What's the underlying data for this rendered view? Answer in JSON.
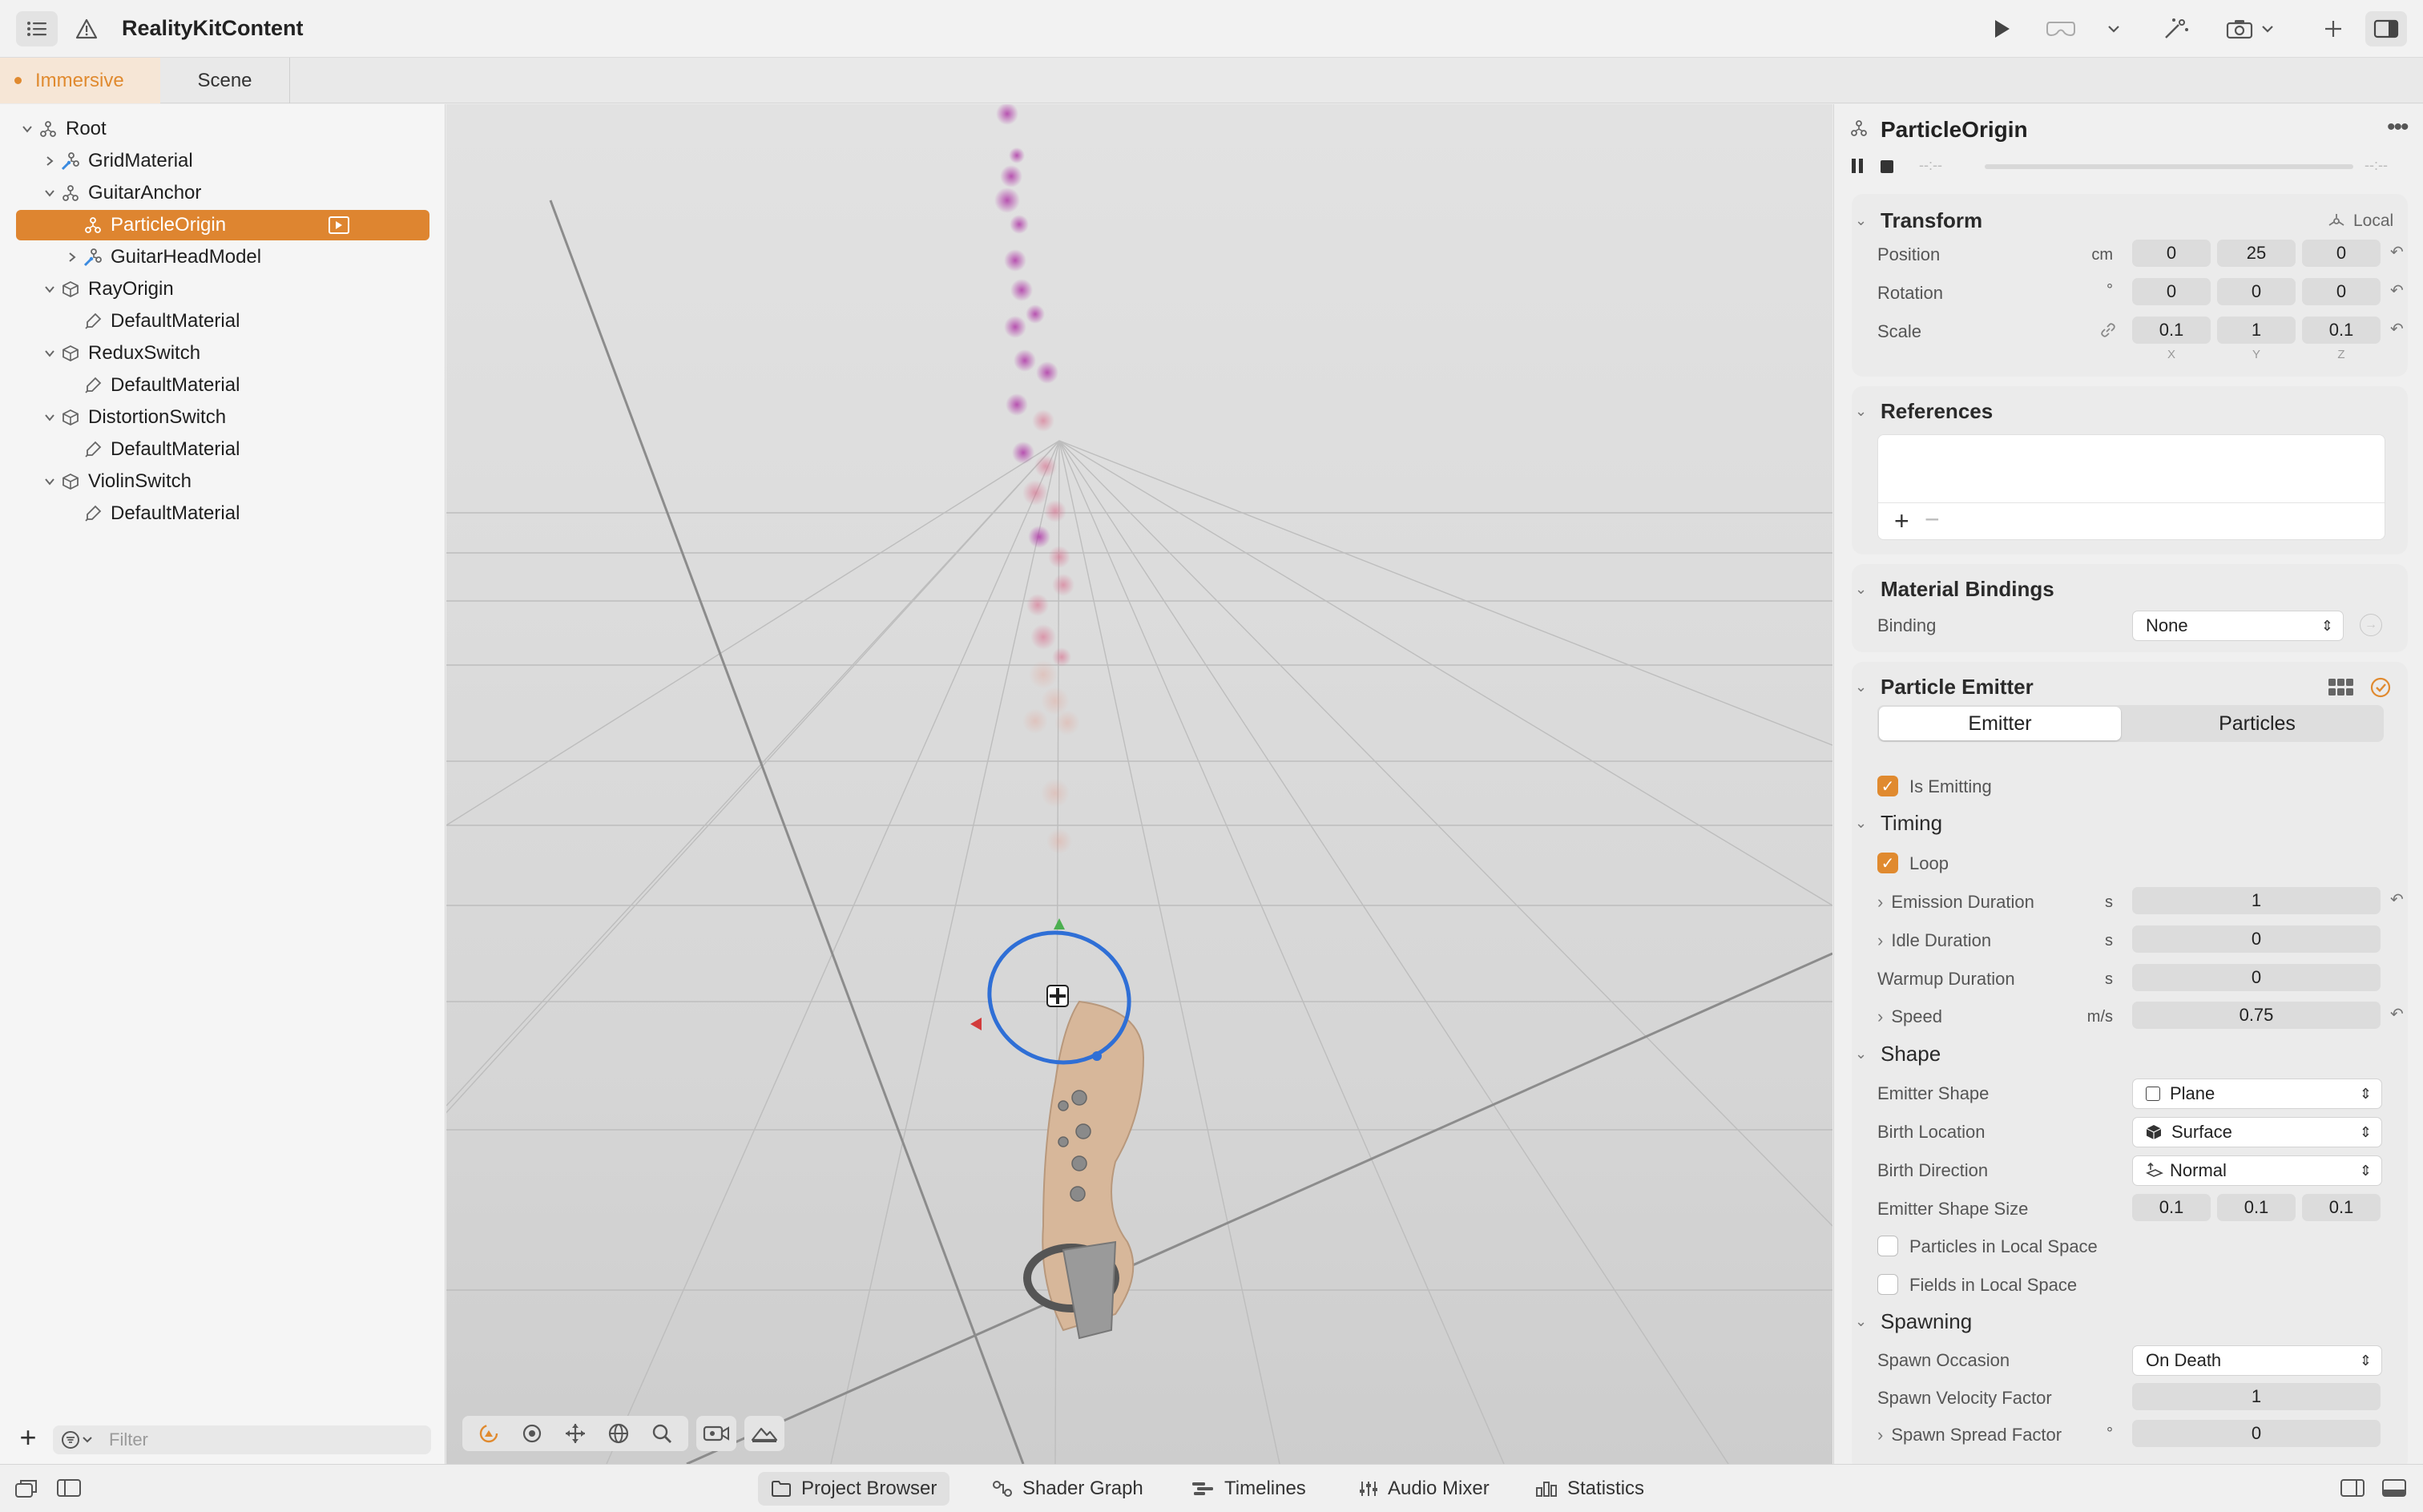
{
  "app": {
    "title": "RealityKitContent"
  },
  "tabs": [
    {
      "label": "Immersive",
      "active": true
    },
    {
      "label": "Scene",
      "active": false
    }
  ],
  "hierarchy": [
    {
      "label": "Root",
      "type": "entity",
      "depth": 0,
      "expanded": true
    },
    {
      "label": "GridMaterial",
      "type": "model",
      "depth": 1,
      "expanded": false
    },
    {
      "label": "GuitarAnchor",
      "type": "entity",
      "depth": 1,
      "expanded": true
    },
    {
      "label": "ParticleOrigin",
      "type": "entity",
      "depth": 2,
      "selected": true
    },
    {
      "label": "GuitarHeadModel",
      "type": "model",
      "depth": 2,
      "expanded": false
    },
    {
      "label": "RayOrigin",
      "type": "cube",
      "depth": 1,
      "expanded": true
    },
    {
      "label": "DefaultMaterial",
      "type": "material",
      "depth": 2
    },
    {
      "label": "ReduxSwitch",
      "type": "cube",
      "depth": 1,
      "expanded": true
    },
    {
      "label": "DefaultMaterial",
      "type": "material",
      "depth": 2
    },
    {
      "label": "DistortionSwitch",
      "type": "cube",
      "depth": 1,
      "expanded": true
    },
    {
      "label": "DefaultMaterial",
      "type": "material",
      "depth": 2
    },
    {
      "label": "ViolinSwitch",
      "type": "cube",
      "depth": 1,
      "expanded": true
    },
    {
      "label": "DefaultMaterial",
      "type": "material",
      "depth": 2
    }
  ],
  "navigator_footer": {
    "filter_placeholder": "Filter"
  },
  "inspector": {
    "entity_name": "ParticleOrigin",
    "playback": {
      "time_start": "--:--",
      "time_end": "--:--"
    },
    "transform": {
      "title": "Transform",
      "space": "Local",
      "position": {
        "label": "Position",
        "unit": "cm",
        "x": "0",
        "y": "25",
        "z": "0"
      },
      "rotation": {
        "label": "Rotation",
        "unit": "°",
        "x": "0",
        "y": "0",
        "z": "0"
      },
      "scale": {
        "label": "Scale",
        "x": "0.1",
        "y": "1",
        "z": "0.1"
      },
      "axes": [
        "X",
        "Y",
        "Z"
      ]
    },
    "references": {
      "title": "References"
    },
    "material_bindings": {
      "title": "Material Bindings",
      "binding_label": "Binding",
      "binding_value": "None"
    },
    "particle_emitter": {
      "title": "Particle Emitter",
      "segments": [
        "Emitter",
        "Particles"
      ],
      "active_segment": "Emitter",
      "is_emitting": {
        "label": "Is Emitting",
        "checked": true
      },
      "timing": {
        "title": "Timing",
        "loop": {
          "label": "Loop",
          "checked": true
        },
        "emission_duration": {
          "label": "Emission Duration",
          "unit": "s",
          "value": "1"
        },
        "idle_duration": {
          "label": "Idle Duration",
          "unit": "s",
          "value": "0"
        },
        "warmup_duration": {
          "label": "Warmup Duration",
          "unit": "s",
          "value": "0"
        },
        "speed": {
          "label": "Speed",
          "unit": "m/s",
          "value": "0.75"
        }
      },
      "shape": {
        "title": "Shape",
        "emitter_shape": {
          "label": "Emitter Shape",
          "value": "Plane"
        },
        "birth_location": {
          "label": "Birth Location",
          "value": "Surface"
        },
        "birth_direction": {
          "label": "Birth Direction",
          "value": "Normal"
        },
        "emitter_shape_size": {
          "label": "Emitter Shape Size",
          "x": "0.1",
          "y": "0.1",
          "z": "0.1"
        },
        "particles_local": {
          "label": "Particles in Local Space",
          "checked": false
        },
        "fields_local": {
          "label": "Fields in Local Space",
          "checked": false
        }
      },
      "spawning": {
        "title": "Spawning",
        "spawn_occasion": {
          "label": "Spawn Occasion",
          "value": "On Death"
        },
        "spawn_velocity_factor": {
          "label": "Spawn Velocity Factor",
          "value": "1"
        },
        "spawn_spread_factor": {
          "label": "Spawn Spread Factor",
          "unit": "°",
          "value": "0"
        }
      }
    }
  },
  "bottom_tabs": [
    {
      "label": "Project Browser",
      "icon": "folder-icon",
      "active": true
    },
    {
      "label": "Shader Graph",
      "icon": "shader-graph-icon",
      "active": false
    },
    {
      "label": "Timelines",
      "icon": "timelines-icon",
      "active": false
    },
    {
      "label": "Audio Mixer",
      "icon": "mixer-icon",
      "active": false
    },
    {
      "label": "Statistics",
      "icon": "statistics-icon",
      "active": false
    }
  ],
  "colors": {
    "accent": "#e08a2f",
    "selection": "#de8530",
    "gizmo_ring": "#2f6fd6"
  }
}
